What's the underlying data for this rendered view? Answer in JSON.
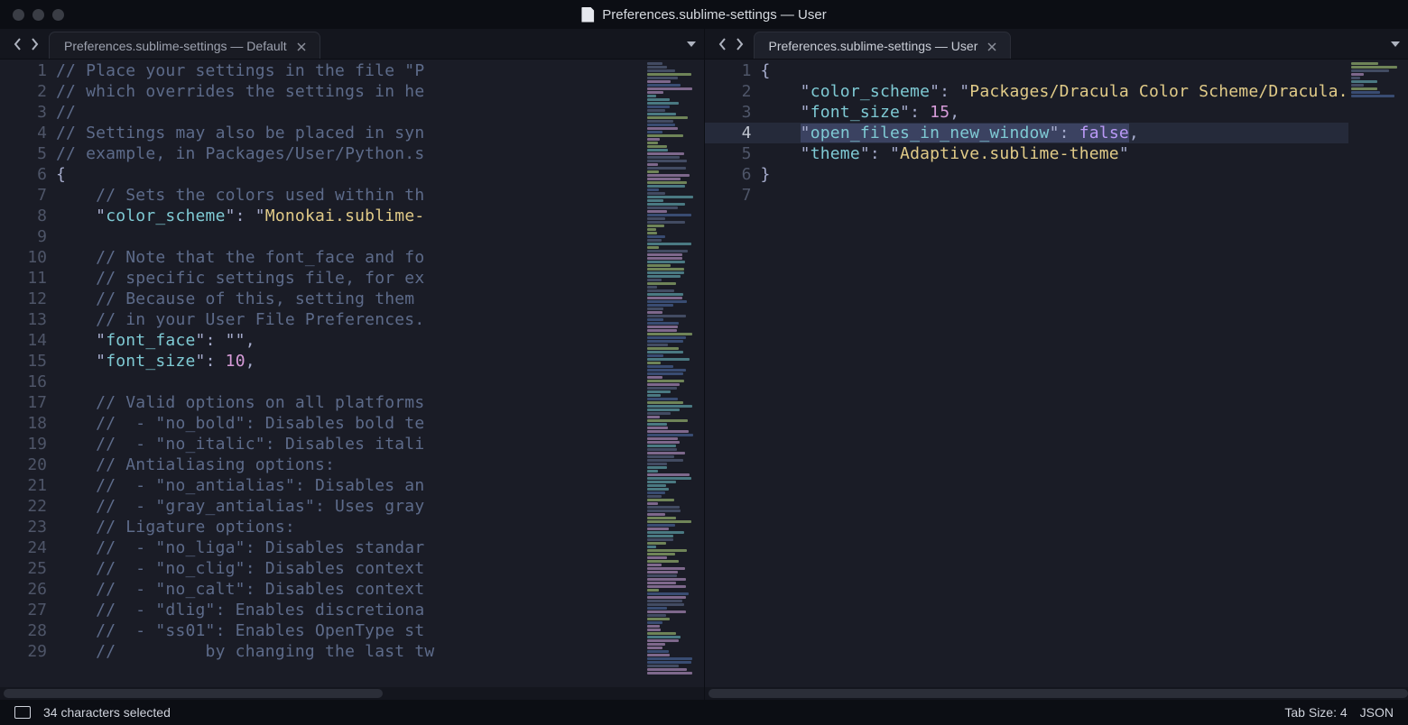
{
  "window": {
    "title": "Preferences.sublime-settings — User"
  },
  "panes": {
    "left": {
      "tab_label": "Preferences.sublime-settings — Default",
      "line_numbers": [
        "1",
        "2",
        "3",
        "4",
        "5",
        "6",
        "7",
        "8",
        "9",
        "10",
        "11",
        "12",
        "13",
        "14",
        "15",
        "16",
        "17",
        "18",
        "19",
        "20",
        "21",
        "22",
        "23",
        "24",
        "25",
        "26",
        "27",
        "28",
        "29"
      ],
      "code_lines": [
        {
          "tokens": [
            {
              "t": "// Place your settings in the file \"P",
              "c": "tok-comment"
            }
          ]
        },
        {
          "tokens": [
            {
              "t": "// which overrides the settings in he",
              "c": "tok-comment"
            }
          ]
        },
        {
          "tokens": [
            {
              "t": "//",
              "c": "tok-comment"
            }
          ]
        },
        {
          "tokens": [
            {
              "t": "// Settings may also be placed in syn",
              "c": "tok-comment"
            }
          ]
        },
        {
          "tokens": [
            {
              "t": "// example, in Packages/User/Python.s",
              "c": "tok-comment"
            }
          ]
        },
        {
          "tokens": [
            {
              "t": "{",
              "c": "tok-punc"
            }
          ]
        },
        {
          "tokens": [
            {
              "t": "    ",
              "c": ""
            },
            {
              "t": "// Sets the colors used within th",
              "c": "tok-comment"
            }
          ]
        },
        {
          "tokens": [
            {
              "t": "    \"",
              "c": "tok-punc"
            },
            {
              "t": "color_scheme",
              "c": "tok-key"
            },
            {
              "t": "\": \"",
              "c": "tok-punc"
            },
            {
              "t": "Monokai.sublime-",
              "c": "tok-value"
            }
          ]
        },
        {
          "tokens": [
            {
              "t": "",
              "c": ""
            }
          ]
        },
        {
          "tokens": [
            {
              "t": "    ",
              "c": ""
            },
            {
              "t": "// Note that the font_face and fo",
              "c": "tok-comment"
            }
          ]
        },
        {
          "tokens": [
            {
              "t": "    ",
              "c": ""
            },
            {
              "t": "// specific settings file, for ex",
              "c": "tok-comment"
            }
          ]
        },
        {
          "tokens": [
            {
              "t": "    ",
              "c": ""
            },
            {
              "t": "// Because of this, setting them ",
              "c": "tok-comment"
            }
          ]
        },
        {
          "tokens": [
            {
              "t": "    ",
              "c": ""
            },
            {
              "t": "// in your User File Preferences.",
              "c": "tok-comment"
            }
          ]
        },
        {
          "tokens": [
            {
              "t": "    \"",
              "c": "tok-punc"
            },
            {
              "t": "font_face",
              "c": "tok-key"
            },
            {
              "t": "\": \"\",",
              "c": "tok-punc"
            }
          ]
        },
        {
          "tokens": [
            {
              "t": "    \"",
              "c": "tok-punc"
            },
            {
              "t": "font_size",
              "c": "tok-key"
            },
            {
              "t": "\": ",
              "c": "tok-punc"
            },
            {
              "t": "10",
              "c": "tok-num"
            },
            {
              "t": ",",
              "c": "tok-punc"
            }
          ]
        },
        {
          "tokens": [
            {
              "t": "",
              "c": ""
            }
          ]
        },
        {
          "tokens": [
            {
              "t": "    ",
              "c": ""
            },
            {
              "t": "// Valid options on all platforms",
              "c": "tok-comment"
            }
          ]
        },
        {
          "tokens": [
            {
              "t": "    ",
              "c": ""
            },
            {
              "t": "//  - \"no_bold\": Disables bold te",
              "c": "tok-comment"
            }
          ]
        },
        {
          "tokens": [
            {
              "t": "    ",
              "c": ""
            },
            {
              "t": "//  - \"no_italic\": Disables itali",
              "c": "tok-comment"
            }
          ]
        },
        {
          "tokens": [
            {
              "t": "    ",
              "c": ""
            },
            {
              "t": "// Antialiasing options:",
              "c": "tok-comment"
            }
          ]
        },
        {
          "tokens": [
            {
              "t": "    ",
              "c": ""
            },
            {
              "t": "//  - \"no_antialias\": Disables an",
              "c": "tok-comment"
            }
          ]
        },
        {
          "tokens": [
            {
              "t": "    ",
              "c": ""
            },
            {
              "t": "//  - \"gray_antialias\": Uses gray",
              "c": "tok-comment"
            }
          ]
        },
        {
          "tokens": [
            {
              "t": "    ",
              "c": ""
            },
            {
              "t": "// Ligature options:",
              "c": "tok-comment"
            }
          ]
        },
        {
          "tokens": [
            {
              "t": "    ",
              "c": ""
            },
            {
              "t": "//  - \"no_liga\": Disables standar",
              "c": "tok-comment"
            }
          ]
        },
        {
          "tokens": [
            {
              "t": "    ",
              "c": ""
            },
            {
              "t": "//  - \"no_clig\": Disables context",
              "c": "tok-comment"
            }
          ]
        },
        {
          "tokens": [
            {
              "t": "    ",
              "c": ""
            },
            {
              "t": "//  - \"no_calt\": Disables context",
              "c": "tok-comment"
            }
          ]
        },
        {
          "tokens": [
            {
              "t": "    ",
              "c": ""
            },
            {
              "t": "//  - \"dlig\": Enables discretiona",
              "c": "tok-comment"
            }
          ]
        },
        {
          "tokens": [
            {
              "t": "    ",
              "c": ""
            },
            {
              "t": "//  - \"ss01\": Enables OpenType st",
              "c": "tok-comment"
            }
          ]
        },
        {
          "tokens": [
            {
              "t": "    ",
              "c": ""
            },
            {
              "t": "//         by changing the last tw",
              "c": "tok-comment"
            }
          ]
        }
      ]
    },
    "right": {
      "tab_label": "Preferences.sublime-settings — User",
      "line_numbers": [
        "1",
        "2",
        "3",
        "4",
        "5",
        "6",
        "7"
      ],
      "highlighted_line": 4,
      "code_lines": [
        {
          "tokens": [
            {
              "t": "{",
              "c": "tok-punc"
            }
          ]
        },
        {
          "tokens": [
            {
              "t": "    \"",
              "c": "tok-punc"
            },
            {
              "t": "color_scheme",
              "c": "tok-key"
            },
            {
              "t": "\": \"",
              "c": "tok-punc"
            },
            {
              "t": "Packages/Dracula Color Scheme/Dracula.tmTheme",
              "c": "tok-value"
            },
            {
              "t": "\",",
              "c": "tok-punc"
            }
          ]
        },
        {
          "tokens": [
            {
              "t": "    \"",
              "c": "tok-punc"
            },
            {
              "t": "font_size",
              "c": "tok-key"
            },
            {
              "t": "\": ",
              "c": "tok-punc"
            },
            {
              "t": "15",
              "c": "tok-num"
            },
            {
              "t": ",",
              "c": "tok-punc"
            }
          ]
        },
        {
          "tokens": [
            {
              "t": "    ",
              "c": ""
            },
            {
              "t": "\"open_files_in_new_window\": false",
              "c": "tok-selected",
              "inner": [
                {
                  "t": "\"",
                  "c": "tok-punc"
                },
                {
                  "t": "open_files_in_new_window",
                  "c": "tok-key"
                },
                {
                  "t": "\": ",
                  "c": "tok-punc"
                },
                {
                  "t": "false",
                  "c": "tok-const"
                }
              ]
            },
            {
              "t": ",",
              "c": "tok-punc"
            }
          ]
        },
        {
          "tokens": [
            {
              "t": "    \"",
              "c": "tok-punc"
            },
            {
              "t": "theme",
              "c": "tok-key"
            },
            {
              "t": "\": \"",
              "c": "tok-punc"
            },
            {
              "t": "Adaptive.sublime-theme",
              "c": "tok-value"
            },
            {
              "t": "\"",
              "c": "tok-punc"
            }
          ]
        },
        {
          "tokens": [
            {
              "t": "}",
              "c": "tok-punc"
            }
          ]
        },
        {
          "tokens": [
            {
              "t": "",
              "c": ""
            }
          ]
        }
      ]
    }
  },
  "statusbar": {
    "selection": "34 characters selected",
    "tab_size": "Tab Size: 4",
    "syntax": "JSON"
  },
  "minimap_colors": [
    "#4e6da5",
    "#a8c97a",
    "#6bb7c0",
    "#c19bd0",
    "#5d6b8a"
  ]
}
